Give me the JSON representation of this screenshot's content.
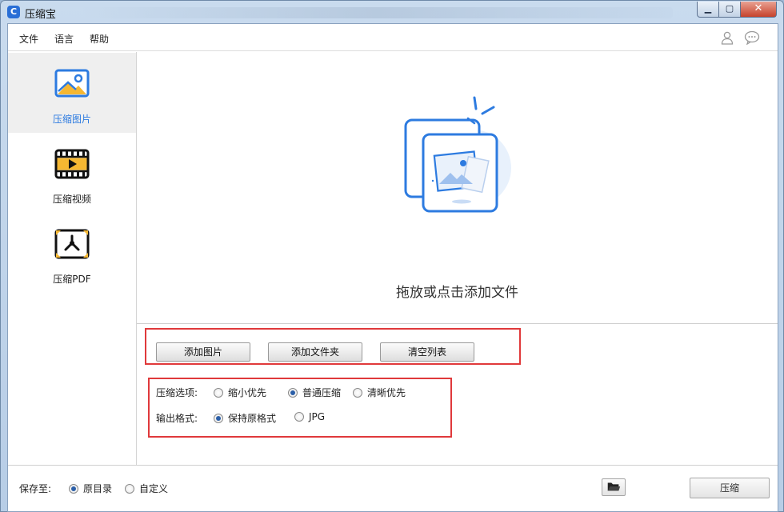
{
  "window": {
    "title": "压缩宝",
    "app_icon_letter": "C"
  },
  "menu": {
    "items": [
      "文件",
      "语言",
      "帮助"
    ]
  },
  "sidebar": {
    "items": [
      {
        "label": "压缩图片",
        "active": true
      },
      {
        "label": "压缩视频",
        "active": false
      },
      {
        "label": "压缩PDF",
        "active": false
      }
    ]
  },
  "drop": {
    "prompt": "拖放或点击添加文件"
  },
  "buttons": {
    "add_images": "添加图片",
    "add_folder": "添加文件夹",
    "clear_list": "清空列表"
  },
  "options": {
    "compress_label": "压缩选项:",
    "compress_choices": [
      "缩小优先",
      "普通压缩",
      "清晰优先"
    ],
    "compress_selected": "普通压缩",
    "format_label": "输出格式:",
    "format_choices": [
      "保持原格式",
      "JPG"
    ],
    "format_selected": "保持原格式"
  },
  "footer": {
    "save_label": "保存至:",
    "save_choices": [
      "原目录",
      "自定义"
    ],
    "save_selected": "原目录",
    "start_label": "压缩"
  },
  "colors": {
    "accent": "#2d7be0",
    "highlight_box": "#e0393b"
  }
}
